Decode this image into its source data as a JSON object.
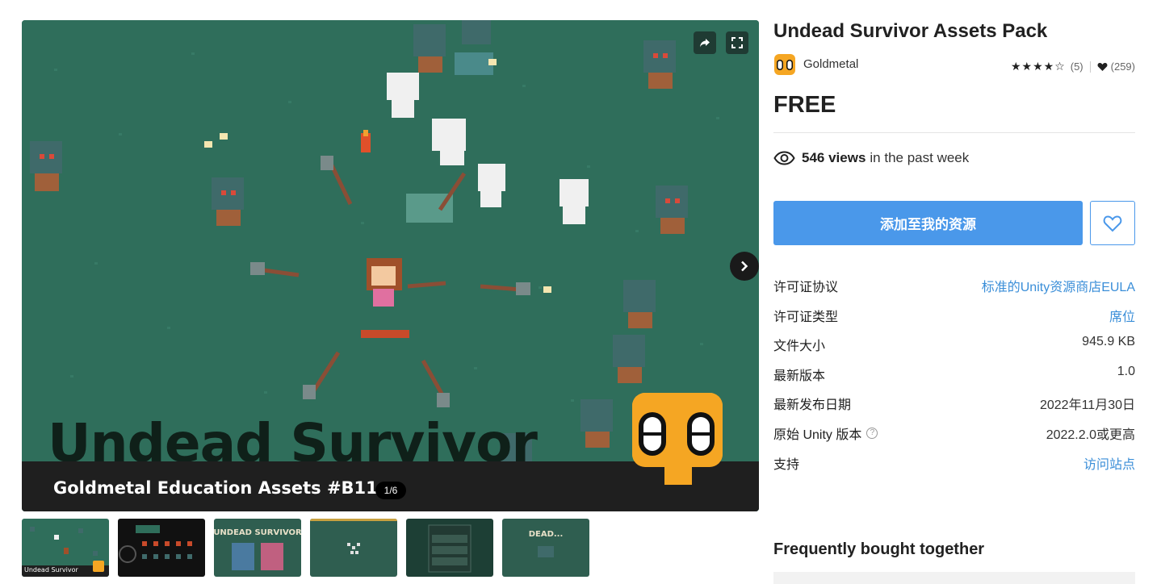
{
  "gallery": {
    "hero_title": "Undead Survivor",
    "hero_subtitle": "Goldmetal Education Assets #B11",
    "counter": "1/6",
    "share_icon": "share-icon",
    "fullscreen_icon": "fullscreen-icon",
    "next_icon": "chevron-right-icon",
    "thumbnails": [
      {
        "label": "Undead Survivor"
      },
      {
        "label": ""
      },
      {
        "label": "UNDEAD SURVIVOR"
      },
      {
        "label": ""
      },
      {
        "label": ""
      },
      {
        "label": "DEAD..."
      }
    ]
  },
  "product": {
    "title": "Undead Survivor Assets Pack",
    "publisher": "Goldmetal",
    "stars": "★★★★☆",
    "rating_count": "(5)",
    "favorites_count": "(259)",
    "price": "FREE",
    "views_count": "546 views",
    "views_suffix": "in the past week"
  },
  "actions": {
    "add_label": "添加至我的资源",
    "favorite_icon": "heart-outline-icon"
  },
  "meta": {
    "license_agreement_label": "许可证协议",
    "license_agreement_value": "标准的Unity资源商店EULA",
    "license_type_label": "许可证类型",
    "license_type_value": "席位",
    "file_size_label": "文件大小",
    "file_size_value": "945.9 KB",
    "latest_version_label": "最新版本",
    "latest_version_value": "1.0",
    "release_date_label": "最新发布日期",
    "release_date_value": "2022年11月30日",
    "unity_version_label": "原始 Unity 版本",
    "unity_version_value": "2022.2.0或更高",
    "support_label": "支持",
    "support_value": "访问站点"
  },
  "sections": {
    "frequently_bought": "Frequently bought together"
  },
  "colors": {
    "accent": "#4a98ea",
    "link": "#3a8ed8",
    "grass": "#2f6e5b"
  }
}
